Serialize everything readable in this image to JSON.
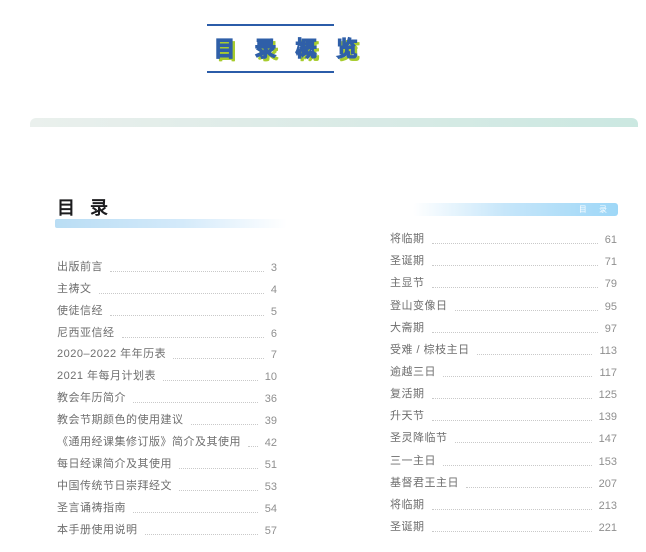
{
  "banner": {
    "title": "目 录 概 览"
  },
  "page": {
    "heading": "目 录",
    "corner_label": "目 录",
    "toc_left": {
      "items": [
        {
          "label": "出版前言",
          "page": "3"
        },
        {
          "label": "主祷文",
          "page": "4"
        },
        {
          "label": "使徒信经",
          "page": "5"
        },
        {
          "label": "尼西亚信经",
          "page": "6"
        },
        {
          "label": "2020–2022 年年历表",
          "page": "7"
        },
        {
          "label": "2021 年每月计划表",
          "page": "10"
        },
        {
          "label": "教会年历简介",
          "page": "36"
        },
        {
          "label": "教会节期颜色的使用建议",
          "page": "39"
        },
        {
          "label": "《通用经课集修订版》简介及其使用",
          "page": "42"
        },
        {
          "label": "每日经课简介及其使用",
          "page": "51"
        },
        {
          "label": "中国传统节日崇拜经文",
          "page": "53"
        },
        {
          "label": "圣言诵祷指南",
          "page": "54"
        },
        {
          "label": "本手册使用说明",
          "page": "57"
        }
      ]
    },
    "toc_right": {
      "items": [
        {
          "label": "将临期",
          "page": "61"
        },
        {
          "label": "圣诞期",
          "page": "71"
        },
        {
          "label": "主显节",
          "page": "79"
        },
        {
          "label": "登山变像日",
          "page": "95"
        },
        {
          "label": "大斋期",
          "page": "97"
        },
        {
          "label": "受难 / 棕枝主日",
          "page": "113"
        },
        {
          "label": "逾越三日",
          "page": "117"
        },
        {
          "label": "复活期",
          "page": "125"
        },
        {
          "label": "升天节",
          "page": "139"
        },
        {
          "label": "圣灵降临节",
          "page": "147"
        },
        {
          "label": "三一主日",
          "page": "153"
        },
        {
          "label": "基督君王主日",
          "page": "207"
        },
        {
          "label": "将临期",
          "page": "213"
        },
        {
          "label": "圣诞期",
          "page": "221"
        }
      ]
    }
  },
  "colors": {
    "banner_line": "#2b5ca9",
    "title_fill": "#ffffff",
    "title_outline": "#2f5fa8",
    "title_shadow": "#a8cc2e",
    "teal_bar_start": "#eaf0ed",
    "teal_bar_end": "#cbe8e1",
    "heading_underline": "#b9ddf4",
    "corner_bar": "#9ed7f7",
    "entry_text": "#6e6e6e",
    "page_number": "#8f8f8f",
    "leader_dots": "#c9c9c9"
  }
}
